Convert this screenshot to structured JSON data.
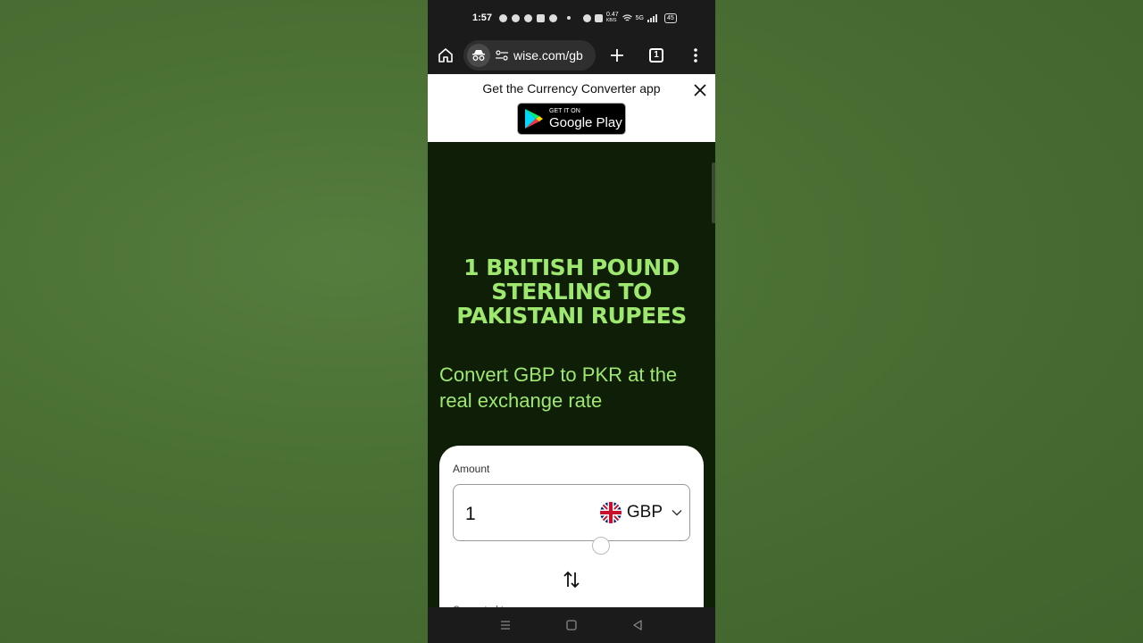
{
  "status_bar": {
    "time": "1:57",
    "speed": "0.47",
    "speed_unit": "KB/S",
    "network": "5G",
    "battery": "45"
  },
  "browser": {
    "url": "wise.com/gb",
    "tab_count": "1"
  },
  "app_banner": {
    "text": "Get the Currency Converter app",
    "store_small": "GET IT ON",
    "store_big": "Google Play"
  },
  "hero": {
    "title_line1": "1 British Pound",
    "title_line2": "Sterling to",
    "title_line3": "Pakistani Rupees",
    "subtitle": "Convert GBP to PKR at the real exchange rate"
  },
  "converter": {
    "amount_label": "Amount",
    "amount_value": "1",
    "currency_code": "GBP",
    "next_label": "Converted to"
  },
  "colors": {
    "page_bg": "#0f1e07",
    "accent_green": "#9fe870",
    "system_bar": "#1b1b1b"
  }
}
